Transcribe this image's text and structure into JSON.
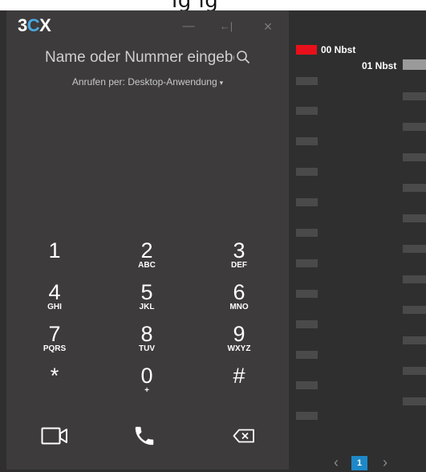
{
  "top_strip": {
    "text": "lg lg"
  },
  "window": {
    "logo": {
      "prefix": "3",
      "accent": "C",
      "suffix": "X"
    },
    "controls": {
      "minimize": "—",
      "dock": "←|",
      "close": "✕"
    }
  },
  "search": {
    "placeholder": "Name oder Nummer eingeben"
  },
  "call_via": {
    "label": "Anrufen per: Desktop-Anwendung",
    "caret": "▾"
  },
  "keypad": [
    {
      "digit": "1",
      "letters": ""
    },
    {
      "digit": "2",
      "letters": "ABC"
    },
    {
      "digit": "3",
      "letters": "DEF"
    },
    {
      "digit": "4",
      "letters": "GHI"
    },
    {
      "digit": "5",
      "letters": "JKL"
    },
    {
      "digit": "6",
      "letters": "MNO"
    },
    {
      "digit": "7",
      "letters": "PQRS"
    },
    {
      "digit": "8",
      "letters": "TUV"
    },
    {
      "digit": "9",
      "letters": "WXYZ"
    },
    {
      "digit": "*",
      "letters": ""
    },
    {
      "digit": "0",
      "letters": "+"
    },
    {
      "digit": "#",
      "letters": ""
    }
  ],
  "actions": [
    "video-call",
    "voice-call",
    "backspace"
  ],
  "chart": {
    "legend": [
      {
        "label": "00 Nbst",
        "color": "#e8101a"
      },
      {
        "label": "01 Nbst",
        "color": "#9a9a9a"
      }
    ],
    "pager": {
      "prev": "‹",
      "page": "1",
      "next": "›"
    }
  },
  "colors": {
    "panel": "#3d3b3c",
    "accent": "#4aa8e0",
    "page_active": "#1e88c8"
  }
}
